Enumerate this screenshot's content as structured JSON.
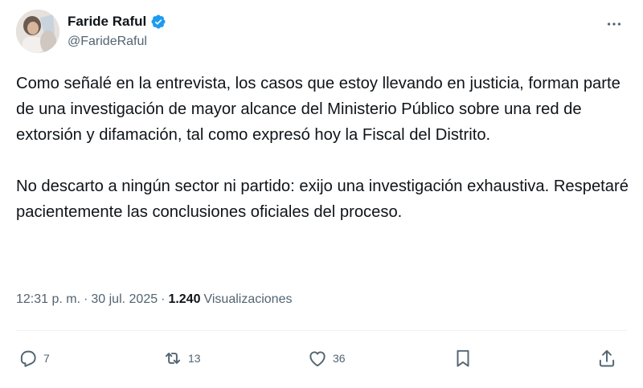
{
  "author": {
    "name": "Faride Raful",
    "handle": "@FarideRaful",
    "verified": true,
    "verified_color": "#1d9bf0"
  },
  "tweet": {
    "paragraphs": [
      "Como señalé en la entrevista, los casos que estoy llevando en justicia, forman parte de una investigación de mayor alcance del Ministerio Público sobre una red de extorsión y difamación, tal como expresó hoy la Fiscal del Distrito.",
      "No descarto a ningún sector ni partido: exijo una investigación exhaustiva. Respetaré pacientemente las conclusiones oficiales del proceso."
    ],
    "time": "12:31 p. m.",
    "separator": "·",
    "date": "30 jul. 2025",
    "views_count": "1.240",
    "views_label": "Visualizaciones"
  },
  "actions": {
    "replies": "7",
    "retweets": "13",
    "likes": "36"
  },
  "icons": [
    "more-icon",
    "reply-icon",
    "retweet-icon",
    "like-icon",
    "bookmark-icon",
    "share-icon",
    "verified-badge-icon"
  ],
  "colors": {
    "text_primary": "#0f1419",
    "text_secondary": "#536471",
    "divider": "#eff3f4"
  }
}
